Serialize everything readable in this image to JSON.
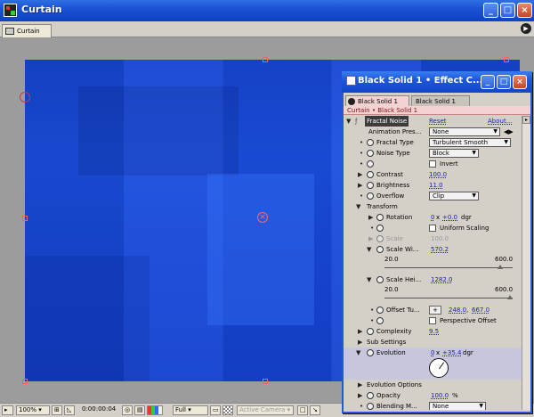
{
  "main_window": {
    "title": "Curtain"
  },
  "comp_tab": {
    "label": "Curtain"
  },
  "bottom_bar": {
    "zoom": "100%",
    "timecode": "0:00:00:04",
    "resolution": "Full",
    "camera": "Active Camera"
  },
  "effect_controls": {
    "title": "Black Solid 1 • Effect C...",
    "tab_active": "Black Solid 1",
    "tab_inactive": "Black Solid 1",
    "breadcrumb": "Curtain • Black Solid 1",
    "effect_name": "Fractal Noise",
    "reset_label": "Reset",
    "about_label": "About...",
    "animation_presets_label": "Animation Pres...",
    "animation_presets_value": "None",
    "fractal_type_label": "Fractal Type",
    "fractal_type_value": "Turbulent Smooth",
    "noise_type_label": "Noise Type",
    "noise_type_value": "Block",
    "invert_label": "Invert",
    "contrast_label": "Contrast",
    "contrast_value": "100.0",
    "brightness_label": "Brightness",
    "brightness_value": "11.0",
    "overflow_label": "Overflow",
    "overflow_value": "Clip",
    "transform_label": "Transform",
    "rotation_label": "Rotation",
    "rotation_rev": "0",
    "rotation_deg": "+0.0",
    "rotation_unit": "dgr",
    "uniform_scaling_label": "Uniform Scaling",
    "scale_label": "Scale",
    "scale_value": "100.0",
    "scale_width_label": "Scale Wi...",
    "scale_width_value": "570.2",
    "scale_width_min": "20.0",
    "scale_width_max": "600.0",
    "scale_height_label": "Scale Hei...",
    "scale_height_value": "1282.0",
    "scale_height_min": "20.0",
    "scale_height_max": "600.0",
    "offset_label": "Offset Tu...",
    "offset_x": "248.0",
    "offset_y": "667.0",
    "perspective_label": "Perspective Offset",
    "complexity_label": "Complexity",
    "complexity_value": "9.5",
    "sub_settings_label": "Sub Settings",
    "evolution_label": "Evolution",
    "evolution_rev": "0",
    "evolution_deg": "+35.4",
    "evolution_unit": "dgr",
    "evolution_options_label": "Evolution Options",
    "opacity_label": "Opacity",
    "opacity_value": "100.0",
    "opacity_unit": "%",
    "blending_label": "Blending M...",
    "blending_value": "None"
  }
}
